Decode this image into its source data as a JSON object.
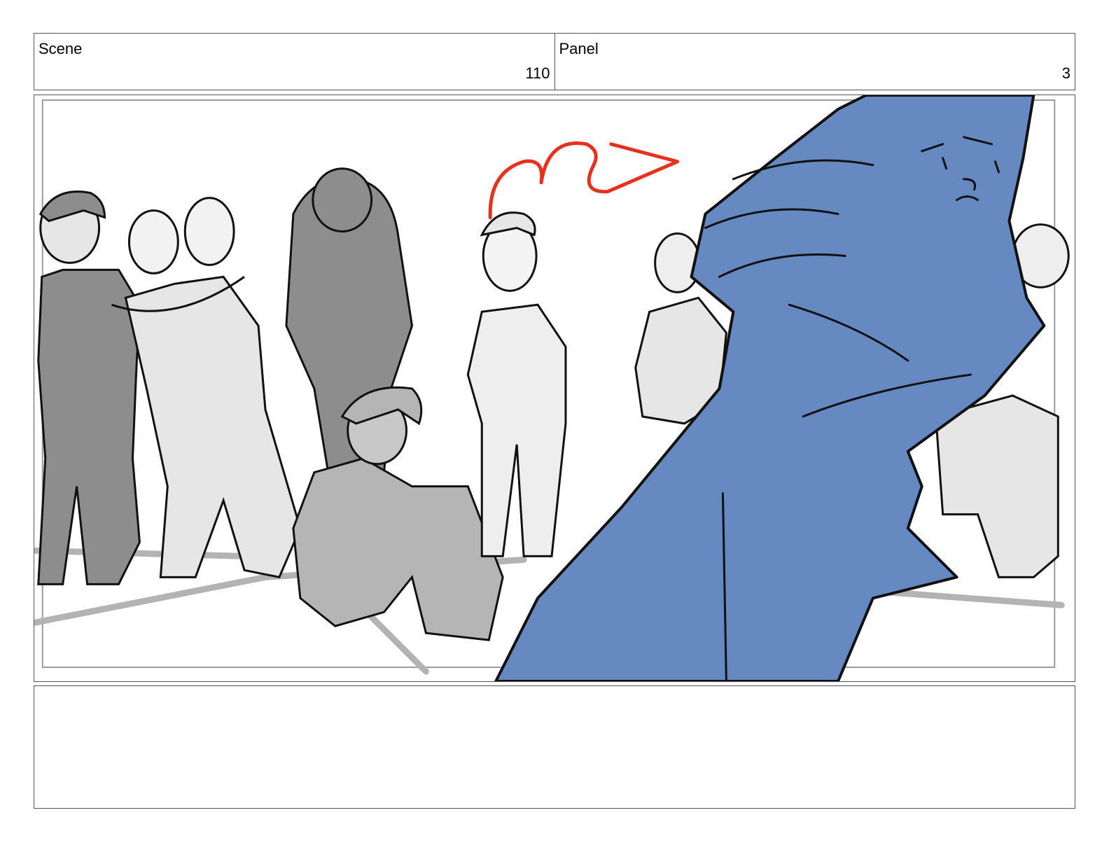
{
  "header": {
    "scene": {
      "label": "Scene",
      "value": "110"
    },
    "panel": {
      "label": "Panel",
      "value": "3"
    }
  },
  "artwork": {
    "subject": "storyboard-sketch",
    "colors": {
      "foreground_figure": "#6589c0",
      "annotation": "#e8301c",
      "light_gray": "#e6e6e6",
      "mid_gray": "#b5b5b5",
      "dark_gray": "#8d8d8d",
      "line": "#111111"
    }
  },
  "notes": {
    "text": ""
  }
}
